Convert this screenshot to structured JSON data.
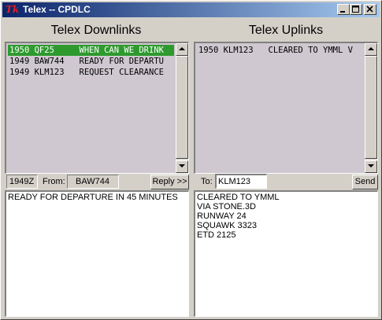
{
  "window": {
    "title": "Telex -- CPDLC",
    "app_icon": "Tk",
    "controls": [
      "minimize-icon",
      "maximize-icon",
      "close-icon"
    ]
  },
  "downlinks": {
    "title": "Telex Downlinks",
    "rows": [
      "1950 QF25     WHEN CAN WE DRINK",
      "1949 BAW744   READY FOR DEPARTU",
      "1949 KLM123   REQUEST CLEARANCE"
    ],
    "selected_index": 0,
    "time": "1949Z",
    "from_label": "From:",
    "from_value": "BAW744",
    "reply_label": "Reply >>",
    "message": "READY FOR DEPARTURE IN 45 MINUTES"
  },
  "uplinks": {
    "title": "Telex Uplinks",
    "rows": [
      "1950 KLM123   CLEARED TO YMML V"
    ],
    "to_label": "To:",
    "to_value": "KLM123",
    "send_label": "Send",
    "message": "CLEARED TO YMML\nVIA STONE.3D\nRUNWAY 24\nSQUAWK 3323\nETD 2125"
  },
  "colors": {
    "selection": "#2e9a2e",
    "list_background": "#cfc8d0",
    "titlebar_start": "#0a246a",
    "titlebar_end": "#a6caf0"
  }
}
